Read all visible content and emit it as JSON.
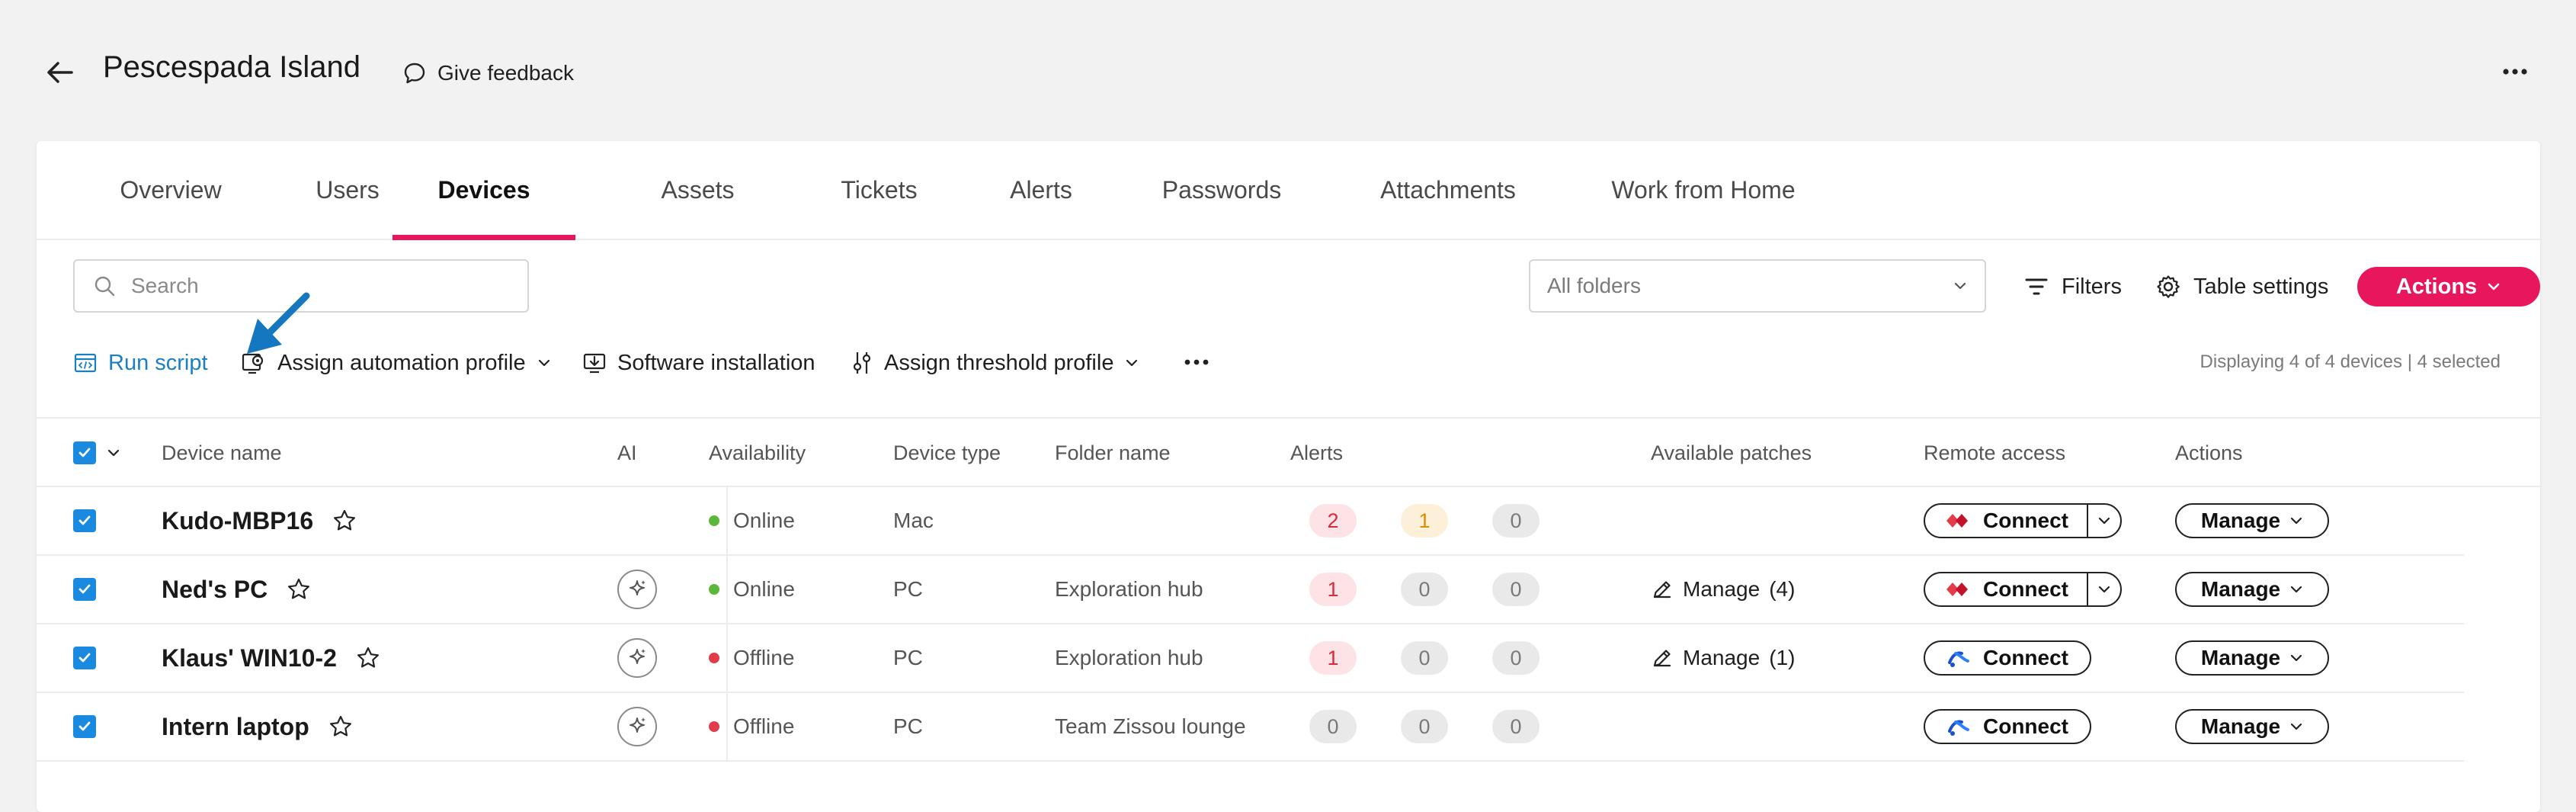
{
  "header": {
    "title": "Pescespada Island",
    "feedback_label": "Give feedback"
  },
  "tabs": [
    {
      "label": "Overview",
      "active": false
    },
    {
      "label": "Users",
      "active": false
    },
    {
      "label": "Devices",
      "active": true
    },
    {
      "label": "Assets",
      "active": false
    },
    {
      "label": "Tickets",
      "active": false
    },
    {
      "label": "Alerts",
      "active": false
    },
    {
      "label": "Passwords",
      "active": false
    },
    {
      "label": "Attachments",
      "active": false
    },
    {
      "label": "Work from Home",
      "active": false
    }
  ],
  "toolbar": {
    "search_placeholder": "Search",
    "folders_value": "All folders",
    "filters_label": "Filters",
    "table_settings_label": "Table settings",
    "actions_label": "Actions"
  },
  "bulk_actions": {
    "run_script": "Run script",
    "assign_automation": "Assign automation profile",
    "software_installation": "Software installation",
    "assign_threshold": "Assign threshold profile",
    "display_count": "Displaying 4 of 4 devices | 4 selected"
  },
  "table": {
    "columns": {
      "device_name": "Device name",
      "ai": "AI",
      "availability": "Availability",
      "device_type": "Device type",
      "folder_name": "Folder name",
      "alerts": "Alerts",
      "available_patches": "Available patches",
      "remote_access": "Remote access",
      "actions": "Actions"
    },
    "rows": [
      {
        "name": "Kudo-MBP16",
        "selected": true,
        "has_ai": false,
        "availability": "Online",
        "status_color": "#5bb83a",
        "device_type": "Mac",
        "folder": "",
        "alerts": [
          "2",
          "1",
          "0"
        ],
        "patch_label": "",
        "patch_count": "",
        "connect_label": "Connect",
        "connect_icon": "red-diamond-icon",
        "split_connect": true,
        "manage_label": "Manage"
      },
      {
        "name": "Ned's PC",
        "selected": true,
        "has_ai": true,
        "availability": "Online",
        "status_color": "#5bb83a",
        "device_type": "PC",
        "folder": "Exploration hub",
        "alerts": [
          "1",
          "0",
          "0"
        ],
        "patch_label": "Manage",
        "patch_count": "(4)",
        "connect_label": "Connect",
        "connect_icon": "red-diamond-icon",
        "split_connect": true,
        "manage_label": "Manage"
      },
      {
        "name": "Klaus' WIN10-2",
        "selected": true,
        "has_ai": true,
        "availability": "Offline",
        "status_color": "#e23b4a",
        "device_type": "PC",
        "folder": "Exploration hub",
        "alerts": [
          "1",
          "0",
          "0"
        ],
        "patch_label": "Manage",
        "patch_count": "(1)",
        "connect_label": "Connect",
        "connect_icon": "blue-swirl-icon",
        "split_connect": false,
        "manage_label": "Manage"
      },
      {
        "name": "Intern laptop",
        "selected": true,
        "has_ai": true,
        "availability": "Offline",
        "status_color": "#e23b4a",
        "device_type": "PC",
        "folder": "Team Zissou lounge",
        "alerts": [
          "0",
          "0",
          "0"
        ],
        "patch_label": "",
        "patch_count": "",
        "connect_label": "Connect",
        "connect_icon": "blue-swirl-icon",
        "split_connect": false,
        "manage_label": "Manage"
      }
    ]
  },
  "colors": {
    "accent": "#e8175d",
    "checkbox": "#1a8ae0",
    "link": "#1a7fc4"
  }
}
